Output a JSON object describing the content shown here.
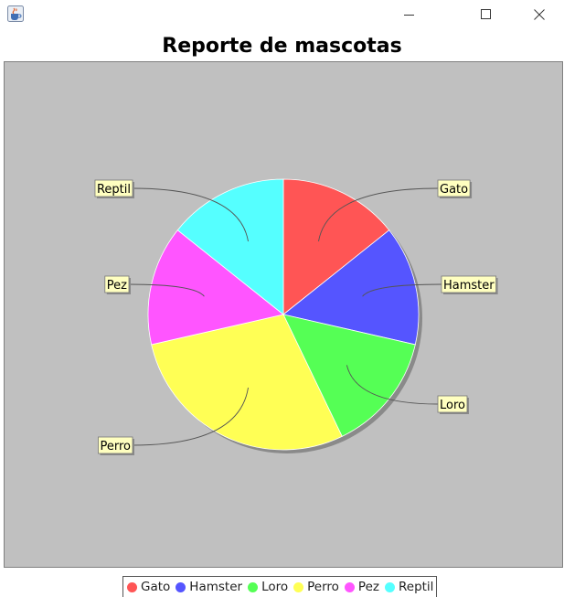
{
  "window": {
    "icon": "java-cup-icon",
    "controls": [
      "minimize-icon",
      "maximize-icon",
      "close-icon"
    ]
  },
  "chart_data": {
    "type": "pie",
    "title": "Reporte de mascotas",
    "categories": [
      "Gato",
      "Hamster",
      "Loro",
      "Perro",
      "Pez",
      "Reptil"
    ],
    "values": [
      1,
      1,
      1,
      2,
      1,
      1
    ],
    "colors": [
      "#ff5555",
      "#5555ff",
      "#55ff55",
      "#ffff55",
      "#ff55ff",
      "#55ffff"
    ],
    "background": "#c0c0c0",
    "label_background": "#ffffc0",
    "shadow": true,
    "legend_position": "bottom"
  }
}
